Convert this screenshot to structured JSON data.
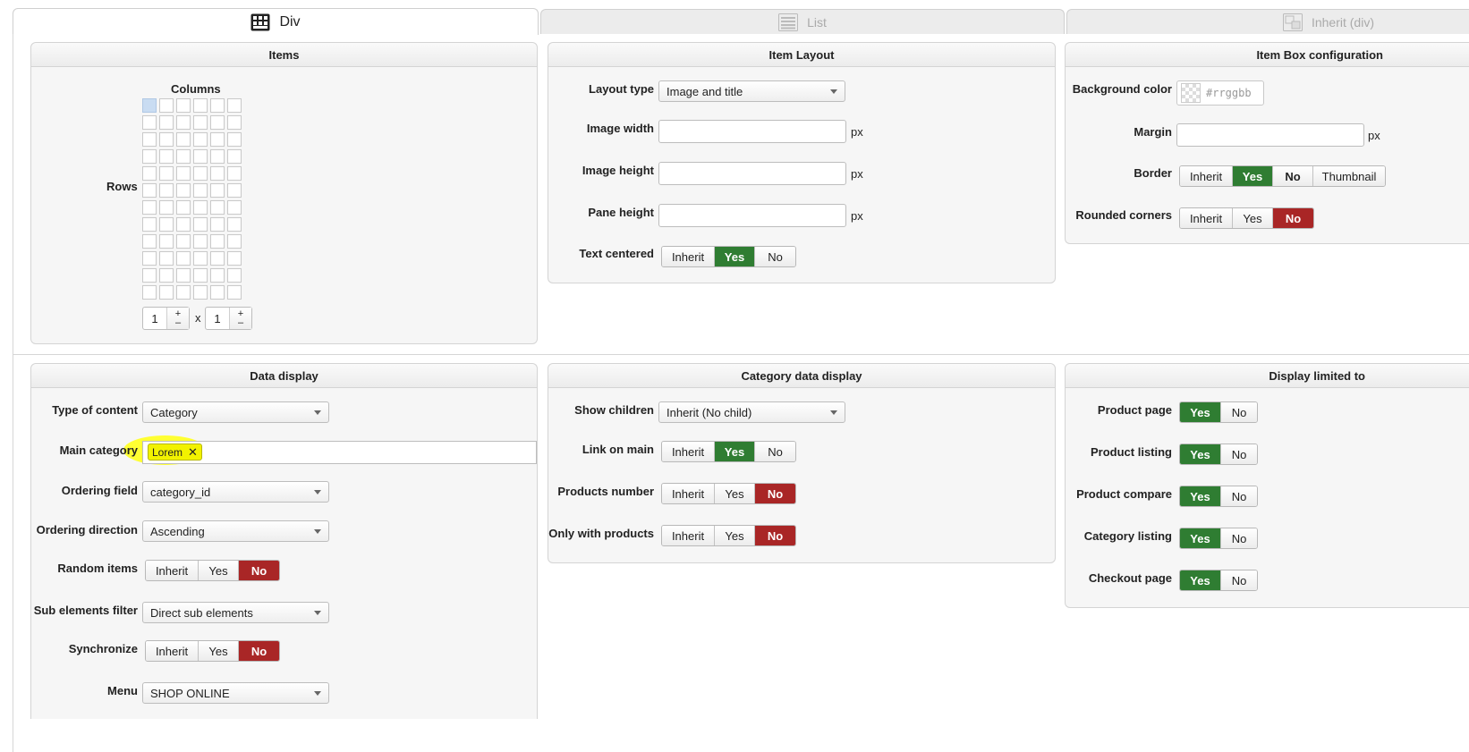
{
  "tabs": [
    {
      "label": "Div",
      "icon": "grid-icon",
      "active": true
    },
    {
      "label": "List",
      "icon": "list-icon",
      "active": false
    },
    {
      "label": "Inherit (div)",
      "icon": "inherit-icon",
      "active": false
    }
  ],
  "items_panel": {
    "title": "Items",
    "columns_label": "Columns",
    "rows_label": "Rows",
    "grid_cols": 6,
    "grid_rows": 12,
    "cols_value": "1",
    "rows_value": "1",
    "x_label": "x"
  },
  "item_layout": {
    "title": "Item Layout",
    "layout_type": {
      "label": "Layout type",
      "value": "Image and title"
    },
    "image_width": {
      "label": "Image width",
      "unit": "px"
    },
    "image_height": {
      "label": "Image height",
      "unit": "px"
    },
    "pane_height": {
      "label": "Pane height",
      "unit": "px"
    },
    "text_centered": {
      "label": "Text centered",
      "options": [
        "Inherit",
        "Yes",
        "No"
      ],
      "selected": "Yes"
    }
  },
  "item_box": {
    "title": "Item Box configuration",
    "bg_color": {
      "label": "Background color",
      "placeholder": "#rrggbb"
    },
    "margin": {
      "label": "Margin",
      "unit": "px"
    },
    "border": {
      "label": "Border",
      "options": [
        "Inherit",
        "Yes",
        "No",
        "Thumbnail"
      ],
      "selected": "Yes"
    },
    "rounded": {
      "label": "Rounded corners",
      "options": [
        "Inherit",
        "Yes",
        "No"
      ],
      "selected": "No"
    }
  },
  "data_display": {
    "title": "Data display",
    "type_of_content": {
      "label": "Type of content",
      "value": "Category"
    },
    "main_category": {
      "label": "Main category",
      "tag": "Lorem"
    },
    "ordering_field": {
      "label": "Ordering field",
      "value": "category_id"
    },
    "ordering_direction": {
      "label": "Ordering direction",
      "value": "Ascending"
    },
    "random_items": {
      "label": "Random items",
      "options": [
        "Inherit",
        "Yes",
        "No"
      ],
      "selected": "No"
    },
    "sub_filter": {
      "label": "Sub elements filter",
      "value": "Direct sub elements"
    },
    "synchronize": {
      "label": "Synchronize",
      "options": [
        "Inherit",
        "Yes",
        "No"
      ],
      "selected": "No"
    },
    "menu": {
      "label": "Menu",
      "value": "SHOP ONLINE"
    }
  },
  "category_data": {
    "title": "Category data display",
    "show_children": {
      "label": "Show children",
      "value": "Inherit (No child)"
    },
    "link_on_main": {
      "label": "Link on main",
      "options": [
        "Inherit",
        "Yes",
        "No"
      ],
      "selected": "Yes"
    },
    "products_number": {
      "label": "Products number",
      "options": [
        "Inherit",
        "Yes",
        "No"
      ],
      "selected": "No"
    },
    "only_with_products": {
      "label": "Only with products",
      "options": [
        "Inherit",
        "Yes",
        "No"
      ],
      "selected": "No"
    }
  },
  "display_limited": {
    "title": "Display limited to",
    "rows": [
      {
        "label": "Product page",
        "options": [
          "Yes",
          "No"
        ],
        "selected": "Yes"
      },
      {
        "label": "Product listing",
        "options": [
          "Yes",
          "No"
        ],
        "selected": "Yes"
      },
      {
        "label": "Product compare",
        "options": [
          "Yes",
          "No"
        ],
        "selected": "Yes"
      },
      {
        "label": "Category listing",
        "options": [
          "Yes",
          "No"
        ],
        "selected": "Yes"
      },
      {
        "label": "Checkout page",
        "options": [
          "Yes",
          "No"
        ],
        "selected": "Yes"
      }
    ]
  },
  "colors": {
    "yes": "#2f7d32",
    "no": "#a92626",
    "highlight": "#ffff33",
    "grid_selected": "#c9dcf2"
  }
}
